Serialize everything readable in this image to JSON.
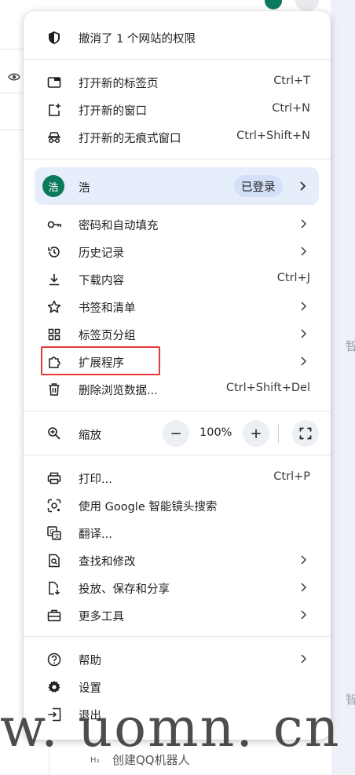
{
  "page": {
    "bg_right_text_1": "智",
    "bg_right_text_2": "智",
    "bg_bottom_heading_tag": "H₃",
    "bg_bottom_text": "创建QQ机器人",
    "bg_eye_icon": "eye-icon"
  },
  "menu": {
    "banner": {
      "label": "撤消了 1 个网站的权限",
      "icon": "shield-icon"
    },
    "group1": [
      {
        "label": "打开新的标签页",
        "shortcut": "Ctrl+T",
        "icon": "new-tab-icon"
      },
      {
        "label": "打开新的窗口",
        "shortcut": "Ctrl+N",
        "icon": "new-window-icon"
      },
      {
        "label": "打开新的无痕式窗口",
        "shortcut": "Ctrl+Shift+N",
        "icon": "incognito-icon"
      }
    ],
    "profile": {
      "avatar": "浩",
      "name": "浩",
      "status": "已登录"
    },
    "group2": [
      {
        "label": "密码和自动填充",
        "icon": "key-icon"
      },
      {
        "label": "历史记录",
        "icon": "history-icon"
      },
      {
        "label": "下载内容",
        "shortcut": "Ctrl+J",
        "icon": "download-icon"
      },
      {
        "label": "书签和清单",
        "icon": "star-icon"
      },
      {
        "label": "标签页分组",
        "icon": "tab-groups-icon"
      },
      {
        "label": "扩展程序",
        "icon": "extension-icon"
      },
      {
        "label": "删除浏览数据...",
        "shortcut": "Ctrl+Shift+Del",
        "icon": "trash-icon"
      }
    ],
    "zoom": {
      "label": "缩放",
      "minus": "−",
      "value": "100%",
      "plus": "+",
      "icon": "zoom-icon"
    },
    "group3": [
      {
        "label": "打印...",
        "shortcut": "Ctrl+P",
        "icon": "print-icon"
      },
      {
        "label": "使用 Google 智能镜头搜索",
        "icon": "lens-icon"
      },
      {
        "label": "翻译...",
        "icon": "translate-icon"
      },
      {
        "label": "查找和修改",
        "icon": "find-icon"
      },
      {
        "label": "投放、保存和分享",
        "icon": "cast-save-share-icon"
      },
      {
        "label": "更多工具",
        "icon": "toolbox-icon"
      }
    ],
    "group4": [
      {
        "label": "帮助",
        "icon": "help-icon"
      },
      {
        "label": "设置",
        "icon": "settings-icon"
      },
      {
        "label": "退出",
        "icon": "exit-icon"
      }
    ]
  },
  "overlay": {
    "highlight_color": "#e53935",
    "watermark": "w. uomn. cn"
  }
}
